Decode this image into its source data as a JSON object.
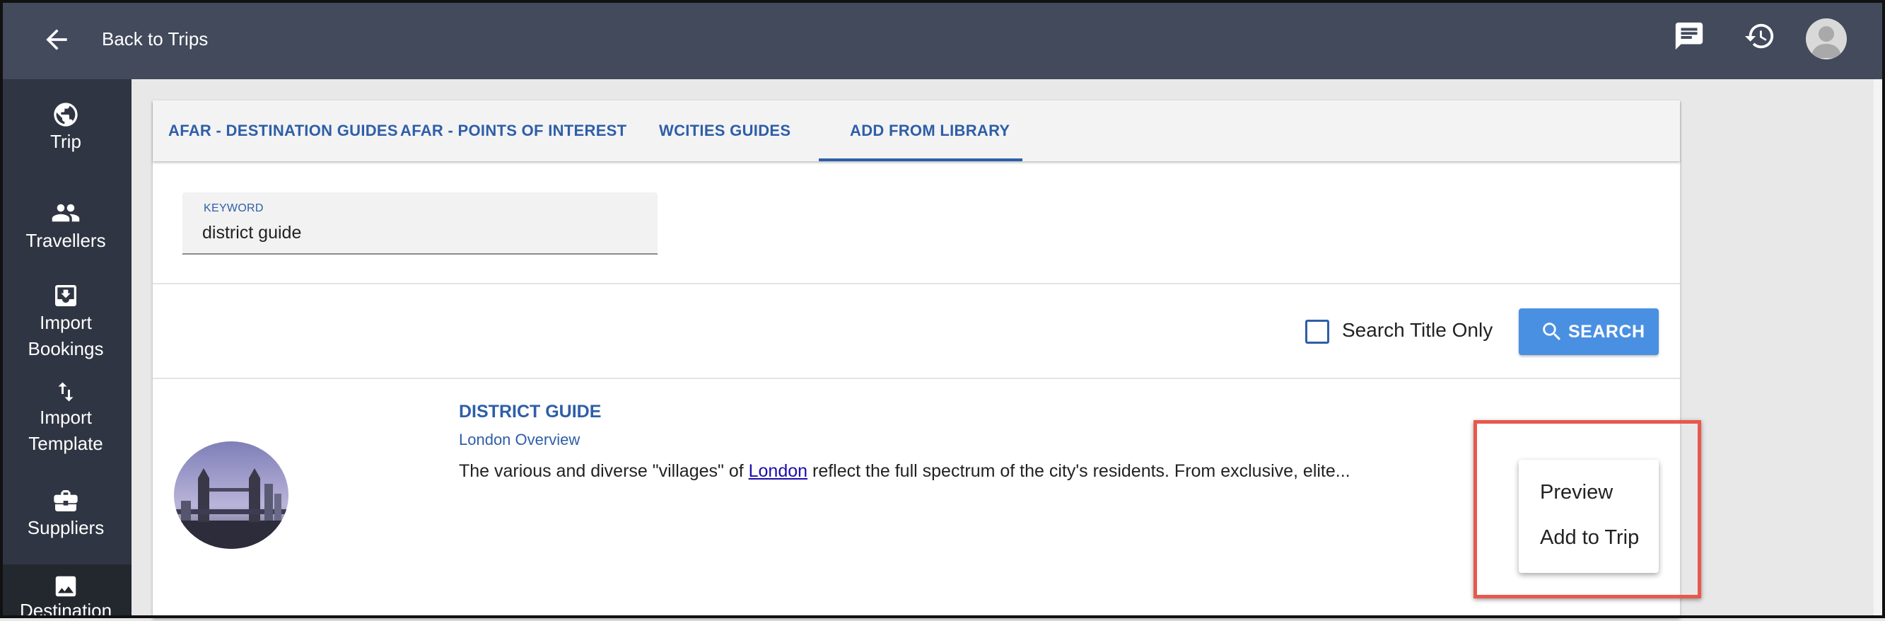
{
  "header": {
    "back_label": "Back to Trips",
    "icons": [
      "arrow-left-icon",
      "chat-icon",
      "history-icon",
      "avatar"
    ]
  },
  "sidebar": {
    "items": [
      {
        "label": "Trip",
        "icon": "globe-icon"
      },
      {
        "label": "Travellers",
        "icon": "people-icon"
      },
      {
        "label": "Import Bookings",
        "icon": "inbox-download-icon"
      },
      {
        "label": "Import Template",
        "icon": "swap-vertical-icon"
      },
      {
        "label": "Suppliers",
        "icon": "briefcase-icon"
      },
      {
        "label": "Destination",
        "icon": "image-icon",
        "active": true
      }
    ]
  },
  "tabs": [
    {
      "label": "AFAR - DESTINATION GUIDES"
    },
    {
      "label": "AFAR - POINTS OF INTEREST"
    },
    {
      "label": "WCITIES GUIDES"
    },
    {
      "label": "ADD FROM LIBRARY",
      "active": true
    }
  ],
  "search": {
    "keyword_label": "KEYWORD",
    "keyword_value": "district guide",
    "title_only_label": "Search Title Only",
    "title_only_checked": false,
    "button_label": "SEARCH"
  },
  "result": {
    "title": "DISTRICT GUIDE",
    "subtitle": "London Overview",
    "desc_before": "The various and diverse \"villages\" of ",
    "desc_link": "London",
    "desc_after": " reflect the full spectrum of the city's residents. From exclusive, elite..."
  },
  "menu": {
    "items": [
      "Preview",
      "Add to Trip"
    ]
  },
  "colors": {
    "topbar": "#424a5c",
    "sidebar": "#2f3542",
    "accent": "#2e5ea8",
    "search_button": "#4a90e2",
    "highlight": "#e8584d"
  }
}
